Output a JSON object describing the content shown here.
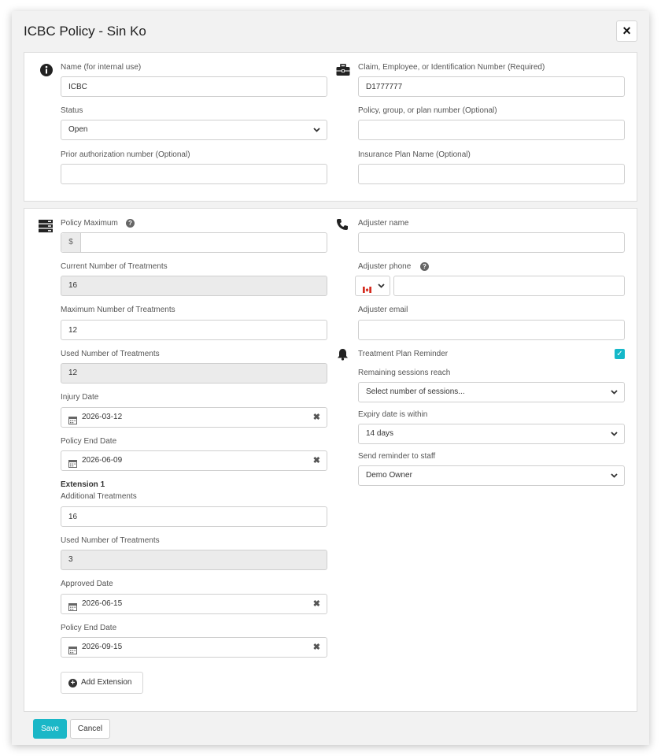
{
  "modal": {
    "title": "ICBC Policy - Sin Ko",
    "close_label": "×"
  },
  "general": {
    "name_label": "Name (for internal use)",
    "name_value": "ICBC",
    "status_label": "Status",
    "status_value": "Open",
    "prior_auth_label": "Prior authorization number (Optional)",
    "prior_auth_value": "",
    "claim_label": "Claim, Employee, or Identification Number (Required)",
    "claim_value": "D1777777",
    "policy_group_label": "Policy, group, or plan number (Optional)",
    "policy_group_value": "",
    "plan_name_label": "Insurance Plan Name (Optional)",
    "plan_name_value": ""
  },
  "policy": {
    "max_label": "Policy Maximum",
    "currency_symbol": "$",
    "max_value": "",
    "current_treatments_label": "Current Number of Treatments",
    "current_treatments_value": "16",
    "max_treatments_label": "Maximum Number of Treatments",
    "max_treatments_value": "12",
    "used_treatments_label": "Used Number of Treatments",
    "used_treatments_value": "12",
    "injury_date_label": "Injury Date",
    "injury_date_value": "2026-03-12",
    "end_date_label": "Policy End Date",
    "end_date_value": "2026-06-09"
  },
  "extension": {
    "title": "Extension 1",
    "additional_label": "Additional Treatments",
    "additional_value": "16",
    "used_label": "Used Number of Treatments",
    "used_value": "3",
    "approved_label": "Approved Date",
    "approved_value": "2026-06-15",
    "end_label": "Policy End Date",
    "end_value": "2026-09-15",
    "add_button_label": "Add Extension"
  },
  "adjuster": {
    "name_label": "Adjuster name",
    "name_value": "",
    "phone_label": "Adjuster phone",
    "phone_value": "",
    "email_label": "Adjuster email",
    "email_value": ""
  },
  "reminder": {
    "label": "Treatment Plan Reminder",
    "checked": true,
    "sessions_label": "Remaining sessions reach",
    "sessions_value": "Select number of sessions...",
    "expiry_label": "Expiry date is within",
    "expiry_value": "14 days",
    "staff_label": "Send reminder to staff",
    "staff_value": "Demo Owner"
  },
  "footer": {
    "save_label": "Save",
    "cancel_label": "Cancel"
  },
  "icons": {
    "help_glyph": "?",
    "clear_glyph": "✖",
    "check_glyph": "✓",
    "plus_glyph": "+",
    "chevron_glyph": "❯"
  },
  "colors": {
    "accent": "#1ab7c7",
    "readonly_bg": "#ebebeb",
    "modal_bg": "#f2f2f2"
  }
}
